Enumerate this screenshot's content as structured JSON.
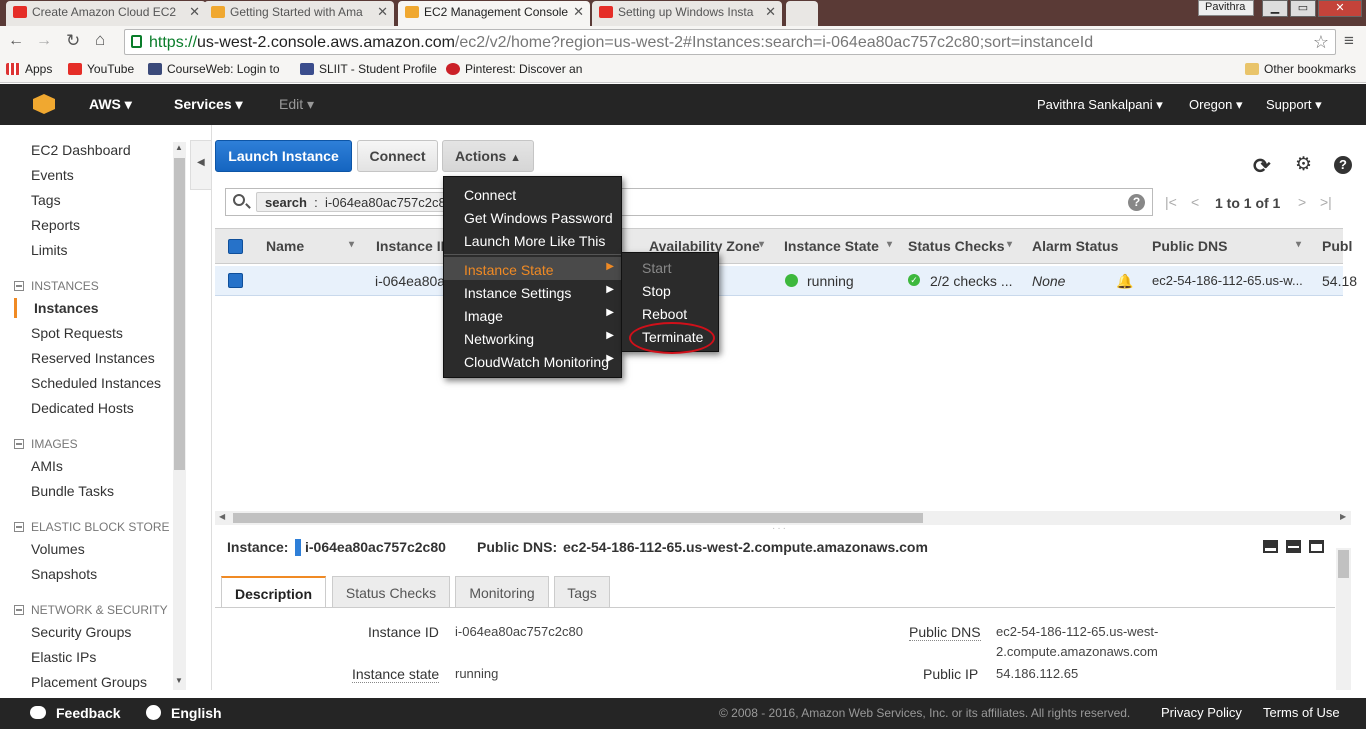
{
  "browser": {
    "tabs": [
      {
        "title": "Create Amazon Cloud EC2"
      },
      {
        "title": "Getting Started with Ama"
      },
      {
        "title": "EC2 Management Console"
      },
      {
        "title": "Setting up Windows Insta"
      }
    ],
    "profile": "Pavithra",
    "url_prefix": "https://",
    "url_host": "us-west-2.console.aws.amazon.com",
    "url_path": "/ec2/v2/home?region=us-west-2#Instances:search=i-064ea80ac757c2c80;sort=instanceId",
    "bookmarks": [
      "Apps",
      "YouTube",
      "CourseWeb: Login to",
      "SLIIT - Student Profile",
      "Pinterest: Discover an"
    ],
    "other_bookmarks": "Other bookmarks"
  },
  "aws_nav": {
    "brand": "AWS",
    "services": "Services",
    "edit": "Edit",
    "user": "Pavithra Sankalpani",
    "region": "Oregon",
    "support": "Support"
  },
  "sidebar": {
    "top": [
      "EC2 Dashboard",
      "Events",
      "Tags",
      "Reports",
      "Limits"
    ],
    "sections": [
      {
        "header": "INSTANCES",
        "items": [
          "Instances",
          "Spot Requests",
          "Reserved Instances",
          "Scheduled Instances",
          "Dedicated Hosts"
        ]
      },
      {
        "header": "IMAGES",
        "items": [
          "AMIs",
          "Bundle Tasks"
        ]
      },
      {
        "header": "ELASTIC BLOCK STORE",
        "items": [
          "Volumes",
          "Snapshots"
        ]
      },
      {
        "header": "NETWORK & SECURITY",
        "items": [
          "Security Groups",
          "Elastic IPs",
          "Placement Groups"
        ]
      }
    ]
  },
  "toolbar": {
    "launch": "Launch Instance",
    "connect": "Connect",
    "actions": "Actions"
  },
  "search": {
    "key": "search",
    "sep": ":",
    "value": "i-064ea80ac757c2c8",
    "pager": "1 to 1 of 1"
  },
  "table": {
    "columns": [
      "Name",
      "Instance ID",
      "Availability Zone",
      "Instance State",
      "Status Checks",
      "Alarm Status",
      "Public DNS",
      "Publ"
    ],
    "row": {
      "instance_id": "i-064ea80ac",
      "state": "running",
      "checks": "2/2 checks ...",
      "alarm": "None",
      "dns": "ec2-54-186-112-65.us-w...",
      "ip": "54.18"
    }
  },
  "actions_menu": {
    "items": [
      "Connect",
      "Get Windows Password",
      "Launch More Like This"
    ],
    "submenus": [
      "Instance State",
      "Instance Settings",
      "Image",
      "Networking",
      "CloudWatch Monitoring"
    ],
    "state_submenu": [
      "Start",
      "Stop",
      "Reboot",
      "Terminate"
    ]
  },
  "detail": {
    "instance_label": "Instance:",
    "instance_id": "i-064ea80ac757c2c80",
    "dns_label": "Public DNS:",
    "dns": "ec2-54-186-112-65.us-west-2.compute.amazonaws.com",
    "tabs": [
      "Description",
      "Status Checks",
      "Monitoring",
      "Tags"
    ],
    "fields": {
      "id_label": "Instance ID",
      "id_value": "i-064ea80ac757c2c80",
      "state_label": "Instance state",
      "state_value": "running",
      "pdns_label": "Public DNS",
      "pdns_value_1": "ec2-54-186-112-65.us-west-",
      "pdns_value_2": "2.compute.amazonaws.com",
      "pip_label": "Public IP",
      "pip_value": "54.186.112.65"
    }
  },
  "footer": {
    "feedback": "Feedback",
    "language": "English",
    "copyright": "© 2008 - 2016, Amazon Web Services, Inc. or its affiliates. All rights reserved.",
    "privacy": "Privacy Policy",
    "terms": "Terms of Use"
  },
  "colors": {
    "aws_orange": "#f08a24",
    "launch_blue": "#1565c0",
    "running_green": "#3db83d",
    "terminate_circle": "#d0101a"
  }
}
